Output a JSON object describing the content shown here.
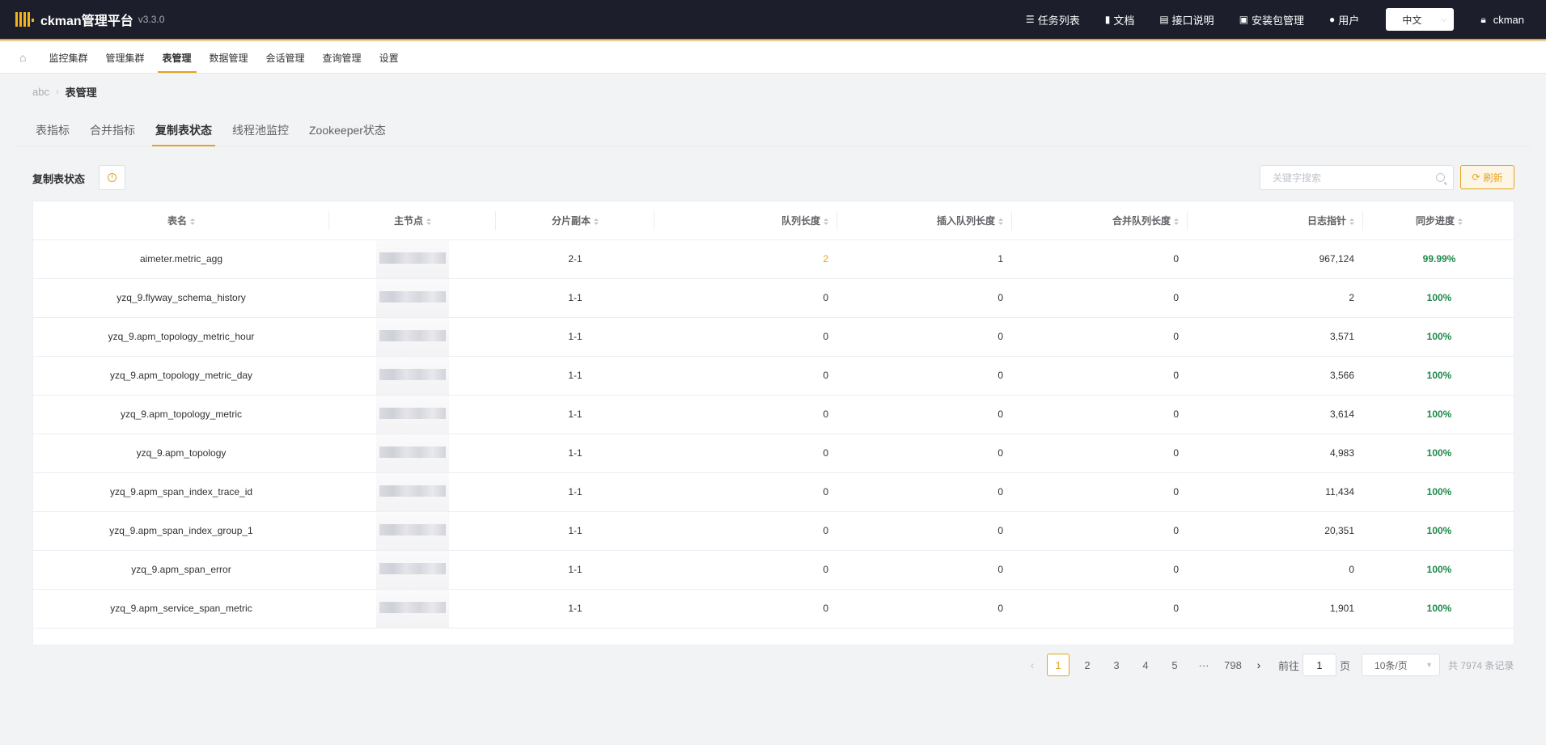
{
  "app": {
    "title": "ckman管理平台",
    "version": "v3.3.0"
  },
  "top_nav": [
    {
      "icon": "list-icon",
      "glyph": "☰",
      "label": "任务列表"
    },
    {
      "icon": "book-icon",
      "glyph": "▮",
      "label": "文档"
    },
    {
      "icon": "document-icon",
      "glyph": "▤",
      "label": "接口说明"
    },
    {
      "icon": "briefcase-icon",
      "glyph": "▣",
      "label": "安装包管理"
    },
    {
      "icon": "users-icon",
      "glyph": "●",
      "label": "用户"
    }
  ],
  "language": {
    "selected": "中文"
  },
  "user": {
    "name": "ckman"
  },
  "menu": {
    "items": [
      {
        "label": "监控集群",
        "active": false
      },
      {
        "label": "管理集群",
        "active": false
      },
      {
        "label": "表管理",
        "active": true
      },
      {
        "label": "数据管理",
        "active": false
      },
      {
        "label": "会话管理",
        "active": false
      },
      {
        "label": "查询管理",
        "active": false
      },
      {
        "label": "设置",
        "active": false
      }
    ]
  },
  "breadcrumb": {
    "parent": "abc",
    "current": "表管理"
  },
  "tabs": [
    {
      "label": "表指标",
      "active": false
    },
    {
      "label": "合并指标",
      "active": false
    },
    {
      "label": "复制表状态",
      "active": true
    },
    {
      "label": "线程池监控",
      "active": false
    },
    {
      "label": "Zookeeper状态",
      "active": false
    }
  ],
  "section": {
    "title": "复制表状态"
  },
  "search": {
    "placeholder": "关键字搜索"
  },
  "refresh": {
    "label": "刷新"
  },
  "table": {
    "columns": [
      "表名",
      "主节点",
      "分片副本",
      "队列长度",
      "插入队列长度",
      "合并队列长度",
      "日志指针",
      "同步进度"
    ],
    "rows": [
      {
        "name": "aimeter.metric_agg",
        "shard": "2-1",
        "queue": "2",
        "insert": "1",
        "merge": "0",
        "log": "967,124",
        "progress": "99.99%"
      },
      {
        "name": "yzq_9.flyway_schema_history",
        "shard": "1-1",
        "queue": "0",
        "insert": "0",
        "merge": "0",
        "log": "2",
        "progress": "100%"
      },
      {
        "name": "yzq_9.apm_topology_metric_hour",
        "shard": "1-1",
        "queue": "0",
        "insert": "0",
        "merge": "0",
        "log": "3,571",
        "progress": "100%"
      },
      {
        "name": "yzq_9.apm_topology_metric_day",
        "shard": "1-1",
        "queue": "0",
        "insert": "0",
        "merge": "0",
        "log": "3,566",
        "progress": "100%"
      },
      {
        "name": "yzq_9.apm_topology_metric",
        "shard": "1-1",
        "queue": "0",
        "insert": "0",
        "merge": "0",
        "log": "3,614",
        "progress": "100%"
      },
      {
        "name": "yzq_9.apm_topology",
        "shard": "1-1",
        "queue": "0",
        "insert": "0",
        "merge": "0",
        "log": "4,983",
        "progress": "100%"
      },
      {
        "name": "yzq_9.apm_span_index_trace_id",
        "shard": "1-1",
        "queue": "0",
        "insert": "0",
        "merge": "0",
        "log": "11,434",
        "progress": "100%"
      },
      {
        "name": "yzq_9.apm_span_index_group_1",
        "shard": "1-1",
        "queue": "0",
        "insert": "0",
        "merge": "0",
        "log": "20,351",
        "progress": "100%"
      },
      {
        "name": "yzq_9.apm_span_error",
        "shard": "1-1",
        "queue": "0",
        "insert": "0",
        "merge": "0",
        "log": "0",
        "progress": "100%"
      },
      {
        "name": "yzq_9.apm_service_span_metric",
        "shard": "1-1",
        "queue": "0",
        "insert": "0",
        "merge": "0",
        "log": "1,901",
        "progress": "100%"
      }
    ]
  },
  "pagination": {
    "pages": [
      "1",
      "2",
      "3",
      "4",
      "5"
    ],
    "ellipsis": "···",
    "last_page": "798",
    "jump_prefix": "前往",
    "jump_value": "1",
    "jump_suffix": "页",
    "page_size": "10条/页",
    "total": "共 7974 条记录"
  },
  "colors": {
    "accent": "#e3a31c",
    "topbar": "#1c1e2b",
    "success": "#1f8a4c"
  }
}
